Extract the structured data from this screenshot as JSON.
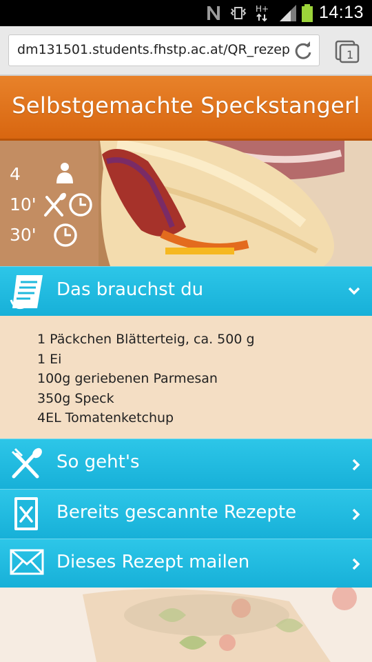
{
  "status_bar": {
    "time": "14:13"
  },
  "browser": {
    "url": "dm131501.students.fhstp.ac.at/QR_rezept"
  },
  "header": {
    "title": "Selbstgemachte Speckstangerl"
  },
  "recipe_info": {
    "servings": "4",
    "prep_time": "10'",
    "total_time": "30'"
  },
  "sections": {
    "ingredients": {
      "label": "Das brauchst du",
      "items": [
        "1 Päckchen Blätterteig, ca. 500 g",
        "1 Ei",
        "100g geriebenen Parmesan",
        "350g Speck",
        "4EL Tomatenketchup"
      ]
    },
    "instructions": {
      "label": "So geht's"
    },
    "scanned": {
      "label": "Bereits gescannte Rezepte"
    },
    "mail": {
      "label": "Dieses Rezept mailen"
    }
  },
  "colors": {
    "header_orange": "#dc6c14",
    "section_blue": "#1fb8dd",
    "ingredients_bg": "#f4dec4"
  },
  "icons": {
    "servings": "person-icon",
    "prep": "utensils-clock-icon",
    "total": "clock-icon",
    "ingredients": "list-icon",
    "instructions": "utensils-icon",
    "scanned": "recipe-book-icon",
    "mail": "envelope-icon"
  }
}
